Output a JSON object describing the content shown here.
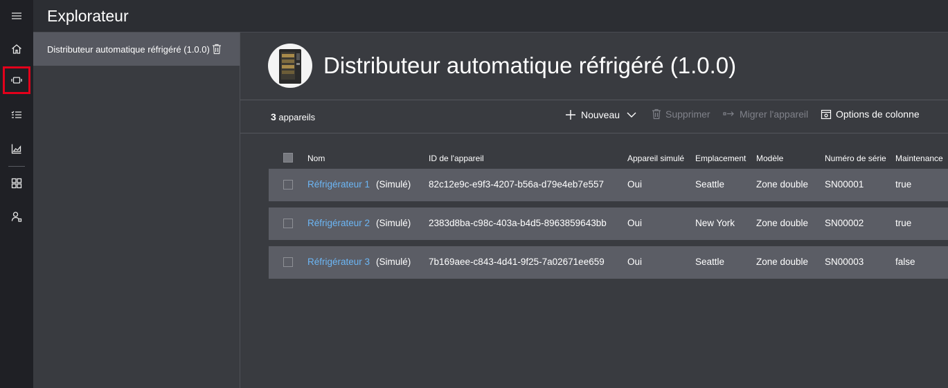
{
  "header": {
    "title": "Explorateur"
  },
  "nav": {
    "items": [
      {
        "name": "menu-icon"
      },
      {
        "name": "home-icon"
      },
      {
        "name": "device-icon",
        "active": true
      },
      {
        "name": "rules-icon"
      },
      {
        "name": "analytics-icon"
      },
      {
        "name": "dashboard-icon"
      },
      {
        "name": "administration-icon"
      }
    ]
  },
  "explorer": {
    "selected_item": "Distributeur automatique réfrigéré (1.0.0)"
  },
  "main": {
    "title": "Distributeur automatique réfrigéré (1.0.0)"
  },
  "toolbar": {
    "count_number": "3",
    "count_label": " appareils",
    "new_label": "Nouveau",
    "delete_label": "Supprimer",
    "migrate_label": "Migrer l'appareil",
    "columns_label": "Options de colonne"
  },
  "table": {
    "columns": [
      "Nom",
      "ID de l'appareil",
      "Appareil simulé",
      "Emplacement",
      "Modèle",
      "Numéro de série",
      "Maintenance"
    ],
    "rows": [
      {
        "name": "Réfrigérateur 1",
        "sim_tag": "(Simulé)",
        "id": "82c12e9c-e9f3-4207-b56a-d79e4eb7e557",
        "simulated": "Oui",
        "location": "Seattle",
        "model": "Zone double",
        "serial": "SN00001",
        "maintenance": "true"
      },
      {
        "name": "Réfrigérateur 2",
        "sim_tag": "(Simulé)",
        "id": "2383d8ba-c98c-403a-b4d5-8963859643bb",
        "simulated": "Oui",
        "location": "New York",
        "model": "Zone double",
        "serial": "SN00002",
        "maintenance": "true"
      },
      {
        "name": "Réfrigérateur 3",
        "sim_tag": "(Simulé)",
        "id": "7b169aee-c843-4d41-9f25-7a02671ee659",
        "simulated": "Oui",
        "location": "Seattle",
        "model": "Zone double",
        "serial": "SN00003",
        "maintenance": "false"
      }
    ]
  },
  "colors": {
    "rail": "#1f2025",
    "background": "#393b40",
    "row": "#5b5d65",
    "link": "#6cb6f5",
    "active_marker": "#e3001b"
  }
}
